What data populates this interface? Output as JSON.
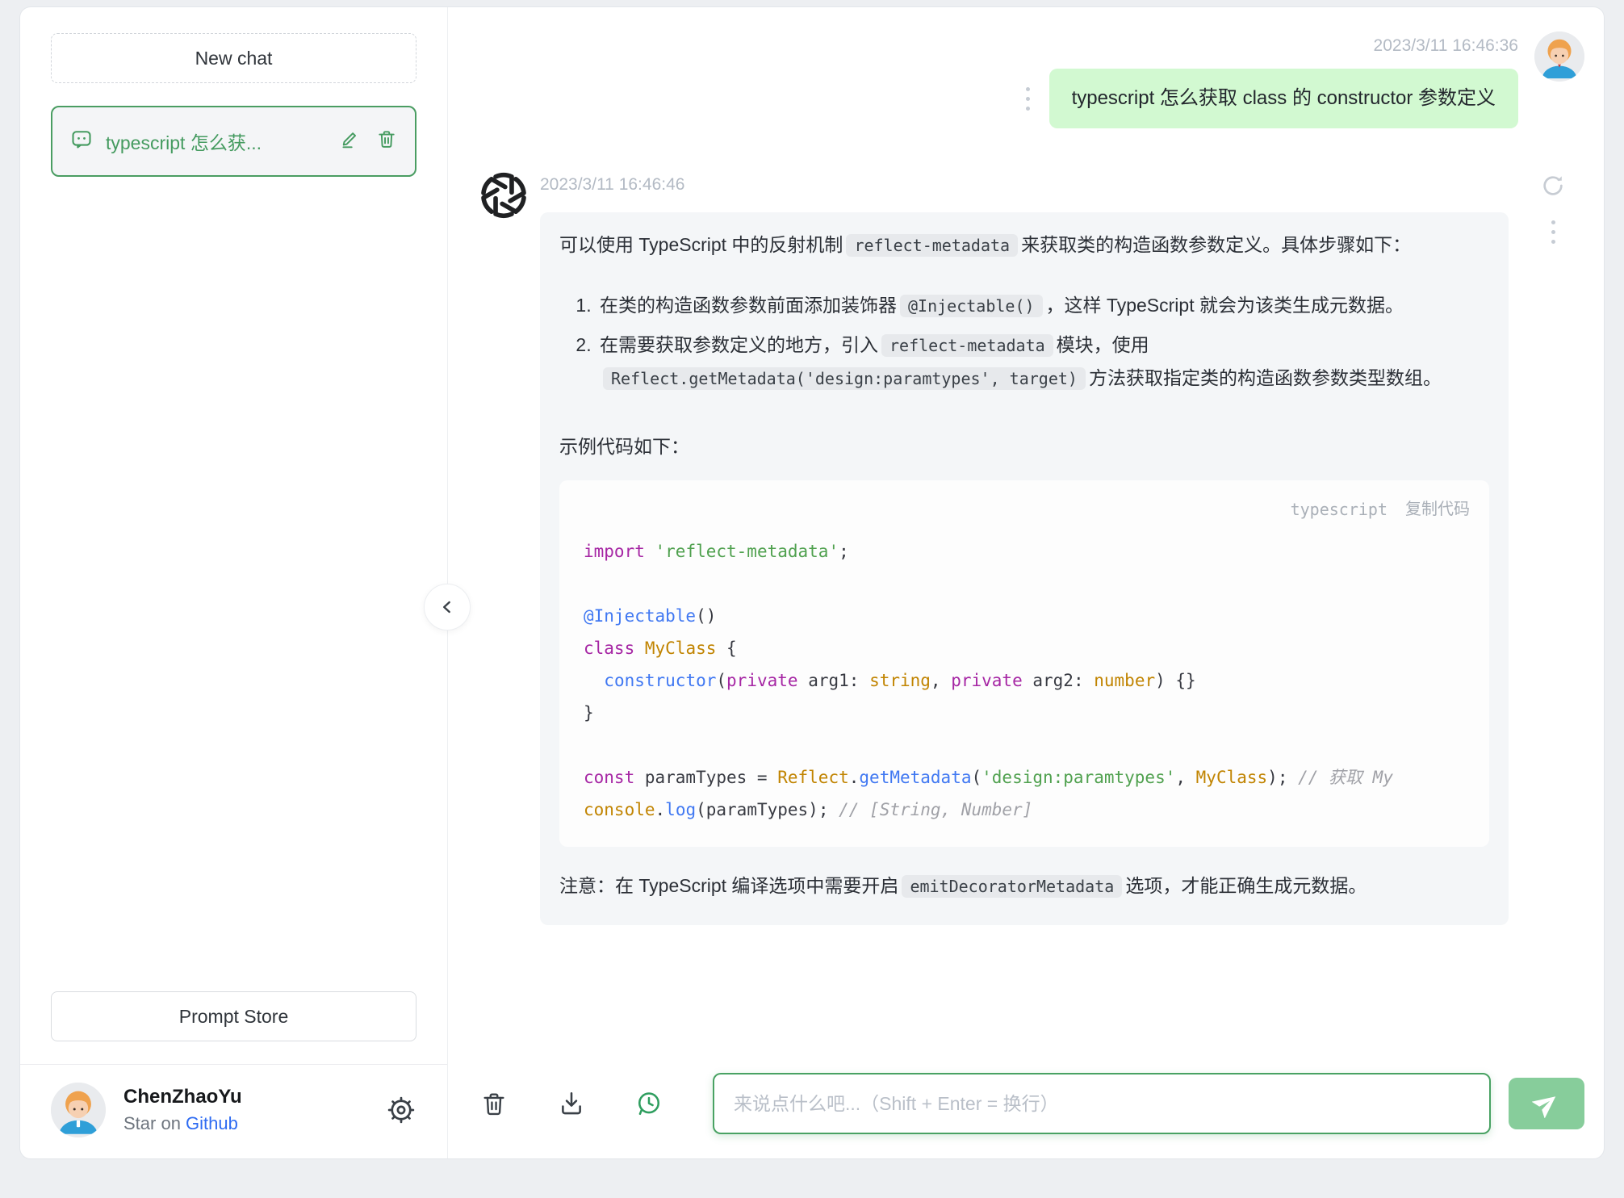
{
  "sidebar": {
    "new_chat_label": "New chat",
    "history_item": {
      "title": "typescript 怎么获..."
    },
    "prompt_store_label": "Prompt Store",
    "user": {
      "name": "ChenZhaoYu",
      "star_prefix": "Star on ",
      "github_link": "Github"
    }
  },
  "chat": {
    "user_message": {
      "timestamp": "2023/3/11 16:46:36",
      "text": "typescript 怎么获取 class 的 constructor 参数定义"
    },
    "assistant_message": {
      "timestamp": "2023/3/11 16:46:46",
      "intro": [
        {
          "t": "可以使用 TypeScript 中的反射机制"
        },
        {
          "t": "reflect-metadata",
          "code": true
        },
        {
          "t": "来获取类的构造函数参数定义。具体步骤如下："
        }
      ],
      "steps": [
        [
          {
            "t": "在类的构造函数参数前面添加装饰器"
          },
          {
            "t": "@Injectable()",
            "code": true
          },
          {
            "t": "，这样 TypeScript 就会为该类生成元数据。"
          }
        ],
        [
          {
            "t": "在需要获取参数定义的地方，引入"
          },
          {
            "t": "reflect-metadata",
            "code": true
          },
          {
            "t": "模块，使用"
          },
          {
            "t": "Reflect.getMetadata('design:paramtypes', target)",
            "code": true
          },
          {
            "t": "方法获取指定类的构造函数参数类型数组。"
          }
        ]
      ],
      "example_label": "示例代码如下：",
      "code_block": {
        "language": "typescript",
        "copy_label": "复制代码",
        "lines": [
          [
            {
              "t": "import",
              "c": "kw"
            },
            {
              "t": " "
            },
            {
              "t": "'reflect-metadata'",
              "c": "str"
            },
            {
              "t": ";"
            }
          ],
          [],
          [
            {
              "t": "@Injectable",
              "c": "fn"
            },
            {
              "t": "()"
            }
          ],
          [
            {
              "t": "class",
              "c": "kw"
            },
            {
              "t": " "
            },
            {
              "t": "MyClass",
              "c": "cls"
            },
            {
              "t": " {"
            }
          ],
          [
            {
              "t": "  "
            },
            {
              "t": "constructor",
              "c": "fn"
            },
            {
              "t": "("
            },
            {
              "t": "private",
              "c": "kw"
            },
            {
              "t": " arg1: "
            },
            {
              "t": "string",
              "c": "cls"
            },
            {
              "t": ", "
            },
            {
              "t": "private",
              "c": "kw"
            },
            {
              "t": " arg2: "
            },
            {
              "t": "number",
              "c": "cls"
            },
            {
              "t": ") {}"
            }
          ],
          [
            {
              "t": "}"
            }
          ],
          [],
          [
            {
              "t": "const",
              "c": "kw"
            },
            {
              "t": " paramTypes = "
            },
            {
              "t": "Reflect",
              "c": "cls"
            },
            {
              "t": "."
            },
            {
              "t": "getMetadata",
              "c": "fn"
            },
            {
              "t": "("
            },
            {
              "t": "'design:paramtypes'",
              "c": "str"
            },
            {
              "t": ", "
            },
            {
              "t": "MyClass",
              "c": "cls"
            },
            {
              "t": "); "
            },
            {
              "t": "// 获取 My",
              "c": "cm"
            }
          ],
          [
            {
              "t": "console",
              "c": "cls"
            },
            {
              "t": "."
            },
            {
              "t": "log",
              "c": "fn"
            },
            {
              "t": "(paramTypes); "
            },
            {
              "t": "// [String, Number]",
              "c": "cm"
            }
          ]
        ]
      },
      "note": [
        {
          "t": "注意：在 TypeScript 编译选项中需要开启"
        },
        {
          "t": "emitDecoratorMetadata",
          "code": true
        },
        {
          "t": "选项，才能正确生成元数据。"
        }
      ]
    }
  },
  "footer": {
    "input_placeholder": "来说点什么吧...（Shift + Enter = 换行）"
  },
  "icons": {
    "history_item": "chat-bubble-icon",
    "edit": "pencil-icon",
    "delete": "trash-icon",
    "settings": "gear-icon",
    "collapse": "chevron-left-icon",
    "assistant": "chatgpt-logo",
    "message_options": "vertical-dots-icon",
    "regenerate": "refresh-icon",
    "clear": "trash-icon",
    "export": "download-icon",
    "context": "chat-history-icon",
    "send": "paper-plane-icon"
  },
  "colors": {
    "accent_green": "#4a9d62",
    "user_bubble": "#d2f9d1",
    "assistant_bubble": "#f4f6f8",
    "send_button": "#87cd9b",
    "link_blue": "#2e6bf2"
  }
}
